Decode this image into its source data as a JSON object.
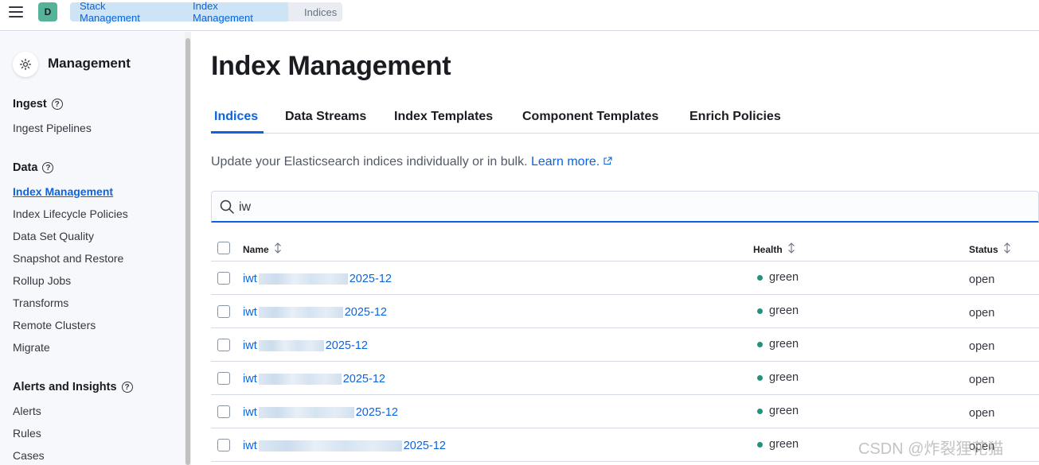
{
  "header": {
    "space_initial": "D",
    "breadcrumbs": [
      "Stack Management",
      "Index Management",
      "Indices"
    ]
  },
  "sidebar": {
    "title": "Management",
    "sections": [
      {
        "heading": "Ingest",
        "items": [
          "Ingest Pipelines"
        ]
      },
      {
        "heading": "Data",
        "items": [
          "Index Management",
          "Index Lifecycle Policies",
          "Data Set Quality",
          "Snapshot and Restore",
          "Rollup Jobs",
          "Transforms",
          "Remote Clusters",
          "Migrate"
        ]
      },
      {
        "heading": "Alerts and Insights",
        "items": [
          "Alerts",
          "Rules",
          "Cases"
        ]
      }
    ],
    "active_item": "Index Management"
  },
  "main": {
    "title": "Index Management",
    "tabs": [
      "Indices",
      "Data Streams",
      "Index Templates",
      "Component Templates",
      "Enrich Policies"
    ],
    "active_tab": "Indices",
    "description": "Update your Elasticsearch indices individually or in bulk.",
    "learn_more": "Learn more.",
    "search": {
      "value": "iw"
    },
    "columns": [
      "Name",
      "Health",
      "Status"
    ],
    "rows": [
      {
        "name_prefix": "iwt",
        "name_suffix": "2025-12",
        "health": "green",
        "status": "open"
      },
      {
        "name_prefix": "iwt",
        "name_suffix": "2025-12",
        "health": "green",
        "status": "open"
      },
      {
        "name_prefix": "iwt",
        "name_suffix": "2025-12",
        "health": "green",
        "status": "open"
      },
      {
        "name_prefix": "iwt",
        "name_suffix": "2025-12",
        "health": "green",
        "status": "open"
      },
      {
        "name_prefix": "iwt",
        "name_suffix": "2025-12",
        "health": "green",
        "status": "open"
      },
      {
        "name_prefix": "iwt",
        "name_suffix": "2025-12",
        "health": "green",
        "status": "open"
      }
    ],
    "health_color": "#209280",
    "accent_color": "#0b64dd"
  },
  "watermark": "CSDN @炸裂狸花猫"
}
